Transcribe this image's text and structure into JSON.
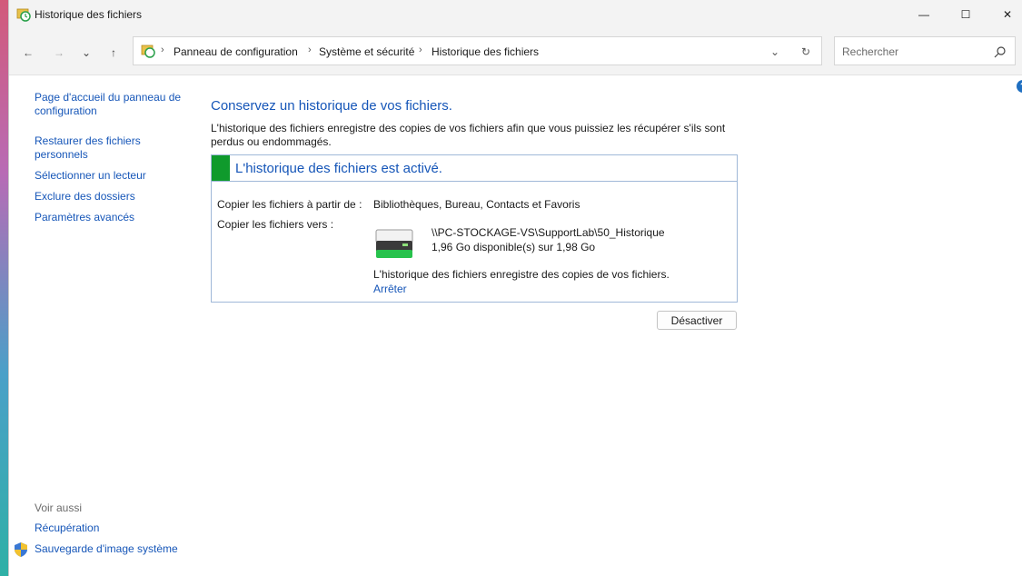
{
  "window": {
    "title": "Historique des fichiers",
    "controls": {
      "minimize": "—",
      "maximize": "☐",
      "close": "✕"
    }
  },
  "toolbar": {
    "back_icon": "←",
    "forward_icon": "→",
    "recent_icon": "⌄",
    "up_icon": "↑",
    "breadcrumbs": [
      "Panneau de configuration",
      "Système et sécurité",
      "Historique des fichiers"
    ],
    "separator": "›",
    "dropdown_icon": "⌄",
    "refresh_icon": "↻",
    "search_placeholder": "Rechercher"
  },
  "sidebar": {
    "links": [
      "Page d'accueil du panneau de configuration",
      "Restaurer des fichiers personnels",
      "Sélectionner un lecteur",
      "Exclure des dossiers",
      "Paramètres avancés"
    ],
    "see_also_label": "Voir aussi",
    "see_also": [
      "Récupération",
      "Sauvegarde d'image système"
    ]
  },
  "main": {
    "heading": "Conservez un historique de vos fichiers.",
    "description": "L'historique des fichiers enregistre des copies de vos fichiers afin que vous puissiez les récupérer s'ils sont perdus ou endommagés.",
    "status": "L'historique des fichiers est activé.",
    "copy_from_label": "Copier les fichiers à partir de :",
    "copy_from_value": "Bibliothèques, Bureau, Contacts et Favoris",
    "copy_to_label": "Copier les fichiers vers :",
    "drive_path": "\\\\PC-STOCKAGE-VS\\SupportLab\\50_Historique",
    "drive_space": "1,96 Go disponible(s) sur 1,98 Go",
    "info": "L'historique des fichiers enregistre des copies de vos fichiers.",
    "stop_link": "Arrêter",
    "disable_button": "Désactiver"
  },
  "help_icon": "?",
  "colors": {
    "link": "#1656b8",
    "status_green": "#0f9a2c",
    "border": "#a0b8d8"
  }
}
